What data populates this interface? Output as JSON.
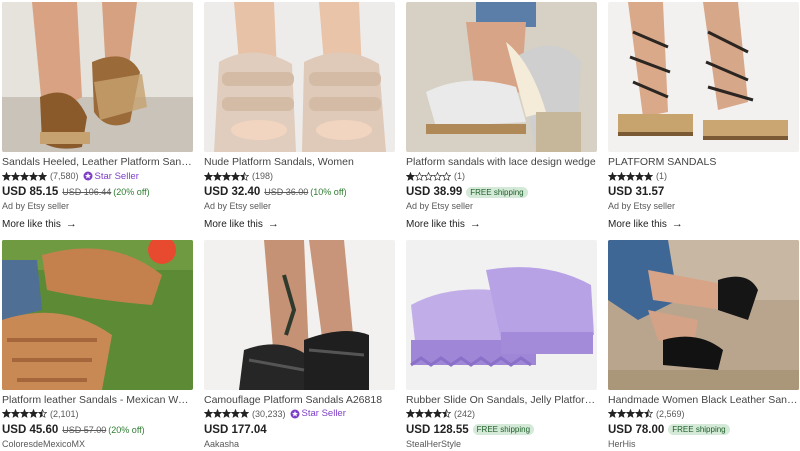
{
  "more_label": "More like this",
  "listings": [
    {
      "title": "Sandals Heeled, Leather Platform Sandals, Sol...",
      "stars": 5,
      "reviews": "(7,580)",
      "star_seller": "Star Seller",
      "price": "USD 85.15",
      "original": "USD 106.44",
      "discount": "(20% off)",
      "free_shipping": "",
      "seller": "Ad by Etsy seller",
      "image_icon": "sandal-photo"
    },
    {
      "title": "Nude Platform Sandals, Women",
      "stars": 4.5,
      "reviews": "(198)",
      "star_seller": "",
      "price": "USD 32.40",
      "original": "USD 36.00",
      "discount": "(10% off)",
      "free_shipping": "",
      "seller": "Ad by Etsy seller",
      "image_icon": "sandal-photo"
    },
    {
      "title": "Platform sandals with lace design wedge",
      "stars": 1,
      "reviews": "(1)",
      "star_seller": "",
      "price": "USD 38.99",
      "original": "",
      "discount": "",
      "free_shipping": "FREE shipping",
      "seller": "Ad by Etsy seller",
      "image_icon": "sandal-photo"
    },
    {
      "title": "PLATFORM SANDALS",
      "stars": 5,
      "reviews": "(1)",
      "star_seller": "",
      "price": "USD 31.57",
      "original": "",
      "discount": "",
      "free_shipping": "",
      "seller": "Ad by Etsy seller",
      "image_icon": "sandal-photo"
    },
    {
      "title": "Platform leather Sandals - Mexican Women Sh...",
      "stars": 4.5,
      "reviews": "(2,101)",
      "star_seller": "",
      "price": "USD 45.60",
      "original": "USD 57.00",
      "discount": "(20% off)",
      "free_shipping": "",
      "seller": "ColoresdeMexicoMX",
      "image_icon": "sandal-photo"
    },
    {
      "title": "Camouflage Platform Sandals A26818",
      "stars": 5,
      "reviews": "(30,233)",
      "star_seller": "Star Seller",
      "price": "USD 177.04",
      "original": "",
      "discount": "",
      "free_shipping": "",
      "seller": "Aakasha",
      "image_icon": "sandal-photo"
    },
    {
      "title": "Rubber Slide On Sandals, Jelly Platform Sandal...",
      "stars": 4.5,
      "reviews": "(242)",
      "star_seller": "",
      "price": "USD 128.55",
      "original": "",
      "discount": "",
      "free_shipping": "FREE shipping",
      "seller": "StealHerStyle",
      "image_icon": "sandal-photo"
    },
    {
      "title": "Handmade Women Black Leather Sandals,Oxfo...",
      "stars": 4.5,
      "reviews": "(2,569)",
      "star_seller": "",
      "price": "USD 78.00",
      "original": "",
      "discount": "",
      "free_shipping": "FREE shipping",
      "seller": "HerHis",
      "image_icon": "sandal-photo"
    }
  ],
  "colors": {
    "star": "#222222",
    "star_seller": "#7e3fc7",
    "discount": "#2f7d32",
    "free_bg": "#d4e9d7"
  }
}
